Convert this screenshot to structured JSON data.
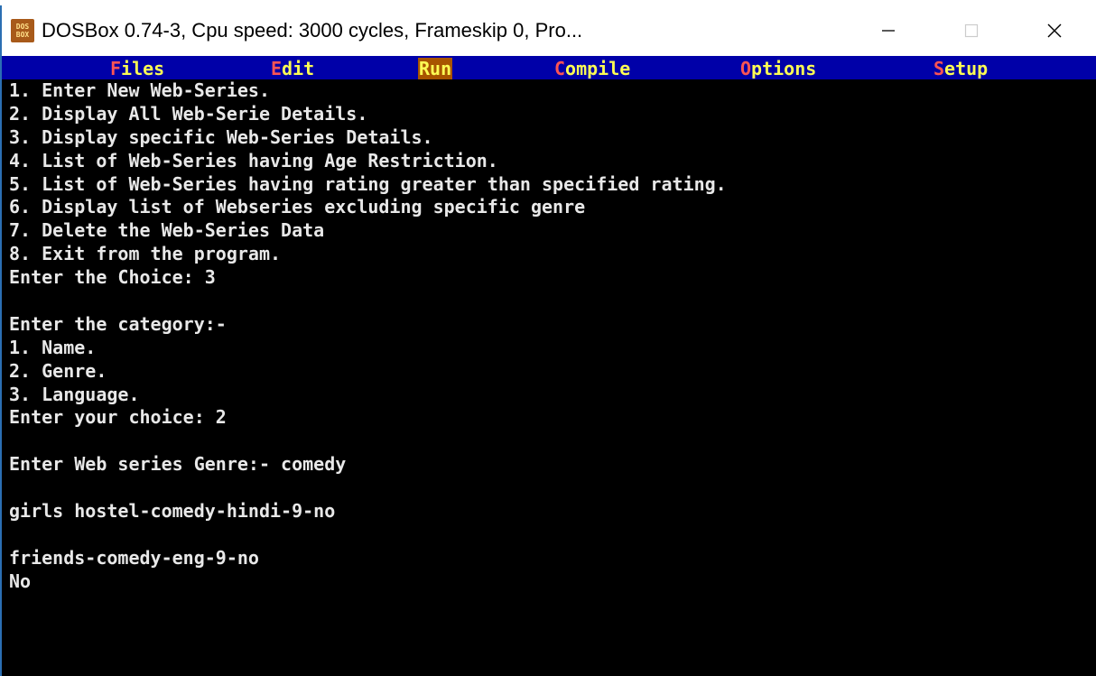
{
  "window": {
    "title": "DOSBox 0.74-3, Cpu speed:    3000 cycles, Frameskip  0, Pro...",
    "icon_top": "DOS",
    "icon_bottom": "BOX",
    "icons": {
      "app": "dosbox-icon",
      "minimize": "minimize-icon",
      "maximize": "maximize-icon",
      "close": "close-icon"
    }
  },
  "menu": {
    "files": {
      "hot": "F",
      "rest": "iles"
    },
    "edit": {
      "hot": "E",
      "rest": "dit"
    },
    "run": {
      "label": "Run"
    },
    "compile": {
      "hot": "C",
      "rest": "ompile"
    },
    "options": {
      "hot": "O",
      "rest": "ptions"
    },
    "setup": {
      "hot": "S",
      "rest": "etup"
    }
  },
  "colors": {
    "menu_bg": "#0000a8",
    "menu_text": "#fcfc54",
    "menu_hotkey": "#fc5454",
    "menu_active_bg": "#a85400",
    "console_bg": "#000000",
    "console_text": "#e8e8e8"
  },
  "console": {
    "lines": [
      "1. Enter New Web-Series.",
      "2. Display All Web-Serie Details.",
      "3. Display specific Web-Series Details.",
      "4. List of Web-Series having Age Restriction.",
      "5. List of Web-Series having rating greater than specified rating.",
      "6. Display list of Webseries excluding specific genre",
      "7. Delete the Web-Series Data",
      "8. Exit from the program.",
      "Enter the Choice: 3",
      "",
      "Enter the category:-",
      "1. Name.",
      "2. Genre.",
      "3. Language.",
      "Enter your choice: 2",
      "",
      "Enter Web series Genre:- comedy",
      "",
      "girls hostel-comedy-hindi-9-no",
      "",
      "friends-comedy-eng-9-no",
      "No"
    ]
  }
}
